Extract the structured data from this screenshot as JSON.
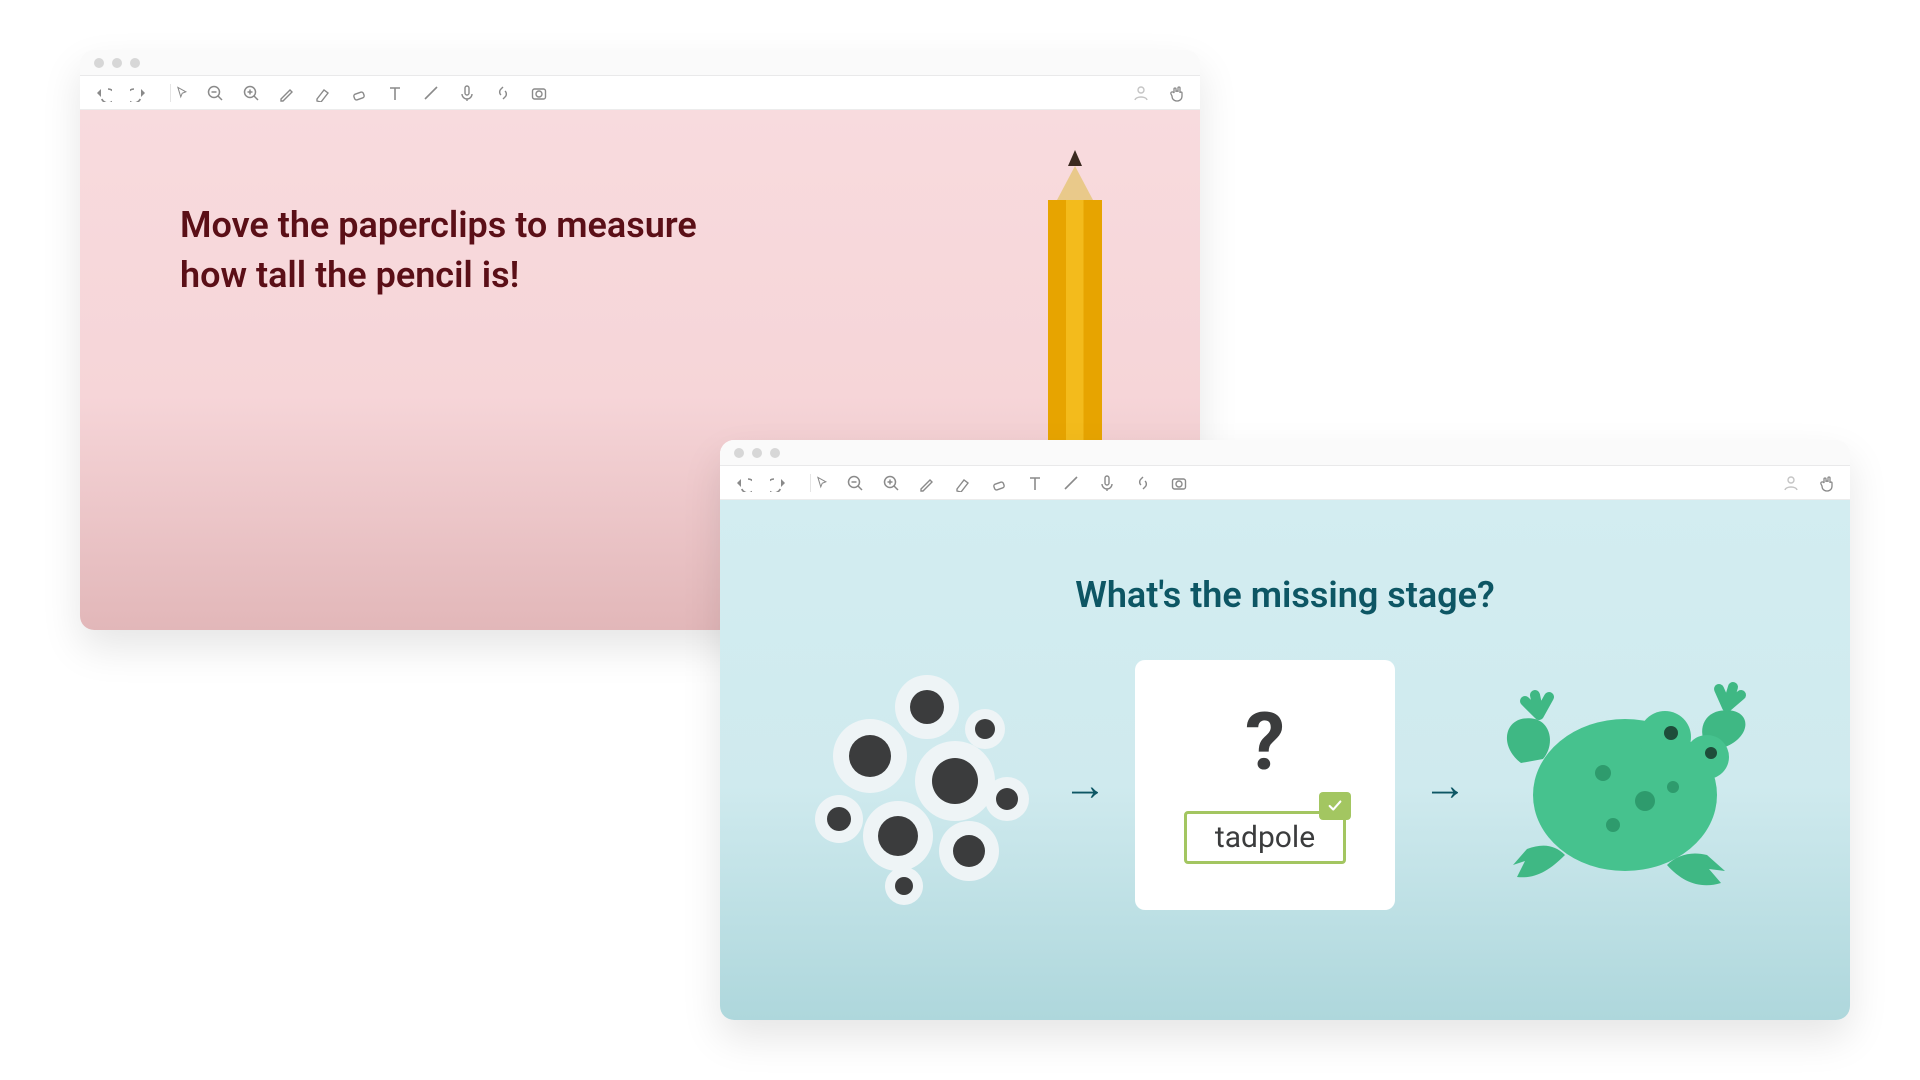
{
  "toolbar": {
    "icons": [
      "undo",
      "redo",
      "pointer",
      "zoom-out",
      "zoom-in",
      "pen",
      "highlighter",
      "eraser",
      "text",
      "line",
      "mic",
      "link",
      "camera"
    ],
    "right_icons": [
      "user",
      "hand"
    ]
  },
  "window1": {
    "prompt_line1": "Move the paperclips to measure",
    "prompt_line2": "how tall the pencil is!"
  },
  "window2": {
    "prompt": "What's the missing stage?",
    "question_mark": "?",
    "answer": "tadpole",
    "arrow": "→"
  },
  "colors": {
    "pink_bg": "#f8dbde",
    "blue_bg": "#d3edf1",
    "prompt1": "#5b0f17",
    "prompt2": "#0d5664",
    "clip_red": "#d31b1b",
    "answer_border": "#a3c661",
    "frog": "#3fb884"
  }
}
